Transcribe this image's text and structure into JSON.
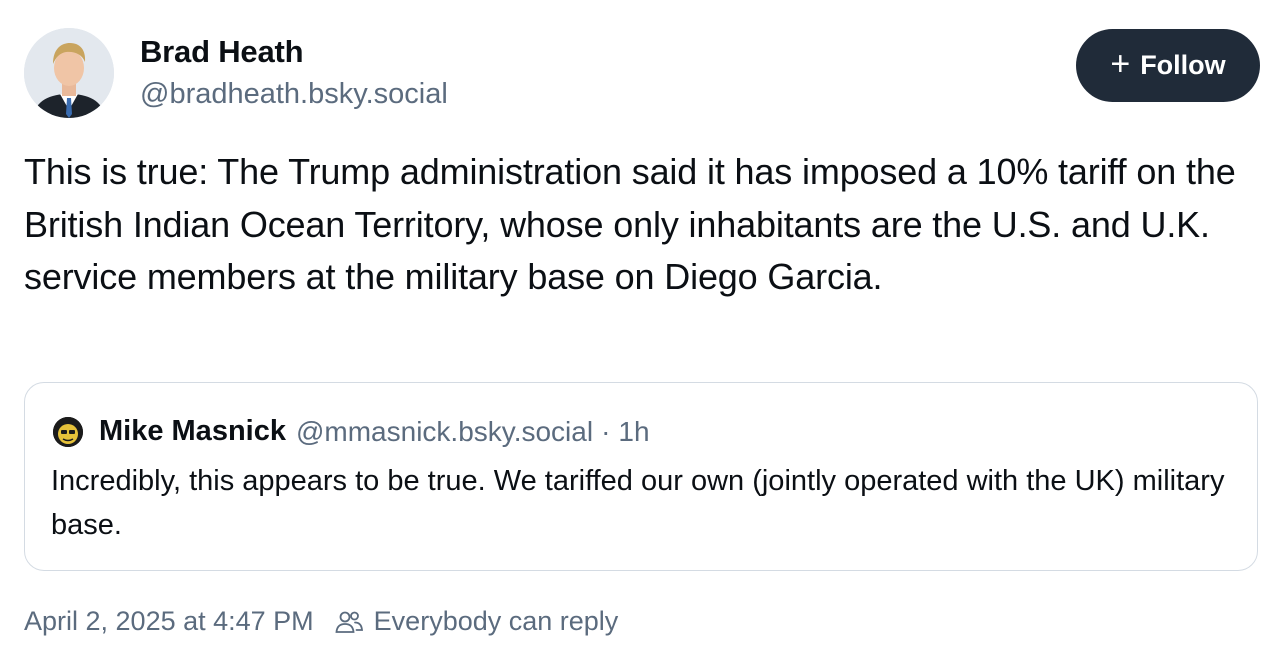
{
  "author": {
    "display_name": "Brad Heath",
    "handle": "@bradheath.bsky.social",
    "avatar_icon": "avatar-photo"
  },
  "follow_button": {
    "label": "Follow",
    "icon": "plus-icon",
    "background": "#202b39"
  },
  "post": {
    "text": "This is true: The Trump administration said it has imposed a 10% tariff on the British Indian Ocean Territory, whose only inhabitants are the U.S. and U.K. service members at the military base on Diego Garcia."
  },
  "quoted_post": {
    "display_name": "Mike Masnick",
    "handle": "@mmasnick.bsky.social",
    "separator": "·",
    "time": "1h",
    "text": "Incredibly, this appears to be true. We tariffed our own (jointly operated with the UK) military base."
  },
  "meta": {
    "timestamp": "April 2, 2025 at 4:47 PM",
    "reply_icon": "people-icon",
    "reply_setting": "Everybody can reply"
  },
  "colors": {
    "text_primary": "#0b0f14",
    "text_secondary": "#5b6b7e",
    "border": "#d4dbe3"
  }
}
